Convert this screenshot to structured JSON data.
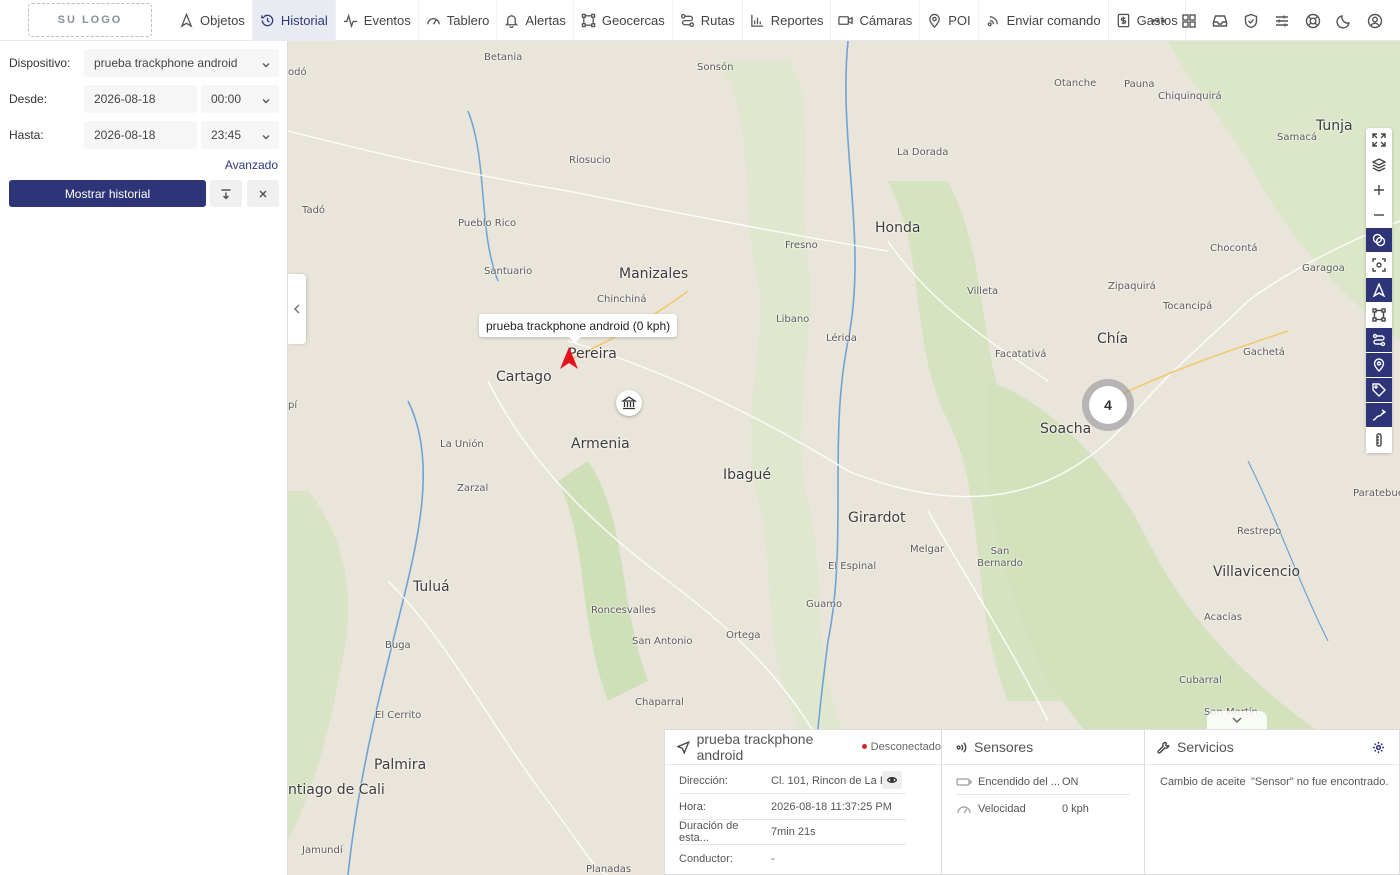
{
  "logo": "SU LOGO",
  "nav": {
    "items": [
      {
        "label": "Objetos",
        "icon": "navigation-arrow-icon",
        "active": false
      },
      {
        "label": "Historial",
        "icon": "history-icon",
        "active": true
      },
      {
        "label": "Eventos",
        "icon": "pulse-icon",
        "active": false
      },
      {
        "label": "Tablero",
        "icon": "gauge-icon",
        "active": false
      },
      {
        "label": "Alertas",
        "icon": "bell-icon",
        "active": false
      },
      {
        "label": "Geocercas",
        "icon": "geofence-icon",
        "active": false
      },
      {
        "label": "Rutas",
        "icon": "route-icon",
        "active": false
      },
      {
        "label": "Reportes",
        "icon": "bar-chart-icon",
        "active": false
      },
      {
        "label": "Cámaras",
        "icon": "camera-icon",
        "active": false
      },
      {
        "label": "POI",
        "icon": "map-pin-icon",
        "active": false
      },
      {
        "label": "Enviar comando",
        "icon": "send-signal-icon",
        "active": false
      },
      {
        "label": "Gastos",
        "icon": "expense-icon",
        "active": false
      }
    ],
    "right_icons": [
      "more-dots-icon",
      "grid-icon",
      "inbox-icon",
      "shield-check-icon",
      "sliders-icon",
      "support-icon",
      "moon-icon",
      "user-icon"
    ]
  },
  "history_form": {
    "device_label": "Dispositivo:",
    "device_value": "prueba trackphone android",
    "from_label": "Desde:",
    "from_date": "2026-08-18",
    "from_time": "00:00",
    "to_label": "Hasta:",
    "to_date": "2026-08-18",
    "to_time": "23:45",
    "advanced_label": "Avanzado",
    "show_button": "Mostrar historial"
  },
  "map": {
    "tooltip": "prueba trackphone android (0 kph)",
    "cluster_count": "4",
    "places": [
      {
        "name": "odó",
        "big": false
      },
      {
        "name": "Betania",
        "big": false
      },
      {
        "name": "Sonsón",
        "big": false
      },
      {
        "name": "Otanche",
        "big": false
      },
      {
        "name": "Pauna",
        "big": false
      },
      {
        "name": "Chiquinquirá",
        "big": false
      },
      {
        "name": "Tunja",
        "big": true
      },
      {
        "name": "Samacá",
        "big": false
      },
      {
        "name": "Riosucio",
        "big": false
      },
      {
        "name": "La Dorada",
        "big": false
      },
      {
        "name": "Tadó",
        "big": false
      },
      {
        "name": "Pueblo Rico",
        "big": false
      },
      {
        "name": "Honda",
        "big": true
      },
      {
        "name": "Fresno",
        "big": false
      },
      {
        "name": "Chocontá",
        "big": false
      },
      {
        "name": "Garagoa",
        "big": false
      },
      {
        "name": "Santuario",
        "big": false
      },
      {
        "name": "Manizales",
        "big": true
      },
      {
        "name": "Zipaquirá",
        "big": false
      },
      {
        "name": "Chinchiná",
        "big": false
      },
      {
        "name": "Villeta",
        "big": false
      },
      {
        "name": "Tocancipá",
        "big": false
      },
      {
        "name": "Libano",
        "big": false
      },
      {
        "name": "Lérida",
        "big": false
      },
      {
        "name": "Chía",
        "big": true
      },
      {
        "name": "Pereira",
        "big": true
      },
      {
        "name": "Facatativá",
        "big": false
      },
      {
        "name": "Gachetá",
        "big": false
      },
      {
        "name": "Cartago",
        "big": true
      },
      {
        "name": "pí",
        "big": false
      },
      {
        "name": "Soacha",
        "big": true
      },
      {
        "name": "Armenia",
        "big": true
      },
      {
        "name": "La Unión",
        "big": false
      },
      {
        "name": "Ibagué",
        "big": true
      },
      {
        "name": "Zarzal",
        "big": false
      },
      {
        "name": "Paratebue",
        "big": false
      },
      {
        "name": "Girardot",
        "big": true
      },
      {
        "name": "Restrepo",
        "big": false
      },
      {
        "name": "Melgar",
        "big": false
      },
      {
        "name": "San Bernardo",
        "big": false
      },
      {
        "name": "El Espinal",
        "big": false
      },
      {
        "name": "Villavicencio",
        "big": true
      },
      {
        "name": "Tuluá",
        "big": true
      },
      {
        "name": "Roncesvalles",
        "big": false
      },
      {
        "name": "Guamo",
        "big": false
      },
      {
        "name": "Acacías",
        "big": false
      },
      {
        "name": "San Antonio",
        "big": false
      },
      {
        "name": "Ortega",
        "big": false
      },
      {
        "name": "Buga",
        "big": false
      },
      {
        "name": "Cubarral",
        "big": false
      },
      {
        "name": "Chaparral",
        "big": false
      },
      {
        "name": "San Martín",
        "big": false
      },
      {
        "name": "El Cerrito",
        "big": false
      },
      {
        "name": "Palmira",
        "big": true
      },
      {
        "name": "ntiago de Cali",
        "big": true
      },
      {
        "name": "Jamundí",
        "big": false
      },
      {
        "name": "Planadas",
        "big": false
      }
    ]
  },
  "device_panel": {
    "title": "prueba trackphone android",
    "status": "Desconectado",
    "rows": [
      {
        "key": "Dirección:",
        "value": "Cl. 101, Rincon de La P..."
      },
      {
        "key": "Hora:",
        "value": "2026-08-18 11:37:25 PM"
      },
      {
        "key": "Duración de esta...",
        "value": "7min 21s"
      },
      {
        "key": "Conductor:",
        "value": "-"
      }
    ]
  },
  "sensors_panel": {
    "title": "Sensores",
    "rows": [
      {
        "name": "Encendido del ...",
        "value": "ON",
        "icon": "ignition-icon"
      },
      {
        "name": "Velocidad",
        "value": "0 kph",
        "icon": "speedometer-icon"
      }
    ]
  },
  "services_panel": {
    "title": "Servicios",
    "service_name": "Cambio de aceite",
    "service_status": "\"Sensor\" no fue encontrado."
  }
}
